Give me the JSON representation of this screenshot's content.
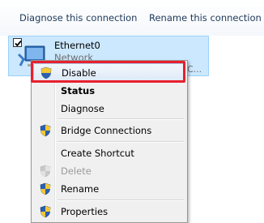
{
  "command_bar": {
    "diagnose_label": "Diagnose this connection",
    "rename_label": "Rename this connection"
  },
  "adapter": {
    "name": "Ethernet0",
    "type": "Network",
    "truncated_device": "C...",
    "checked": true
  },
  "context_menu": {
    "items": [
      {
        "label": "Disable",
        "icon": "uac-shield-icon",
        "highlighted": true
      },
      {
        "label": "Status",
        "bold": true
      },
      {
        "label": "Diagnose"
      },
      {
        "label": "Bridge Connections",
        "icon": "uac-shield-icon"
      },
      {
        "label": "Create Shortcut"
      },
      {
        "label": "Delete",
        "icon": "uac-shield-icon",
        "disabled": true
      },
      {
        "label": "Rename",
        "icon": "uac-shield-icon"
      },
      {
        "label": "Properties",
        "icon": "uac-shield-icon"
      }
    ]
  },
  "colors": {
    "highlight_border": "#e8202e",
    "selection_bg": "#cce8ff",
    "link_text": "#1e395b"
  }
}
